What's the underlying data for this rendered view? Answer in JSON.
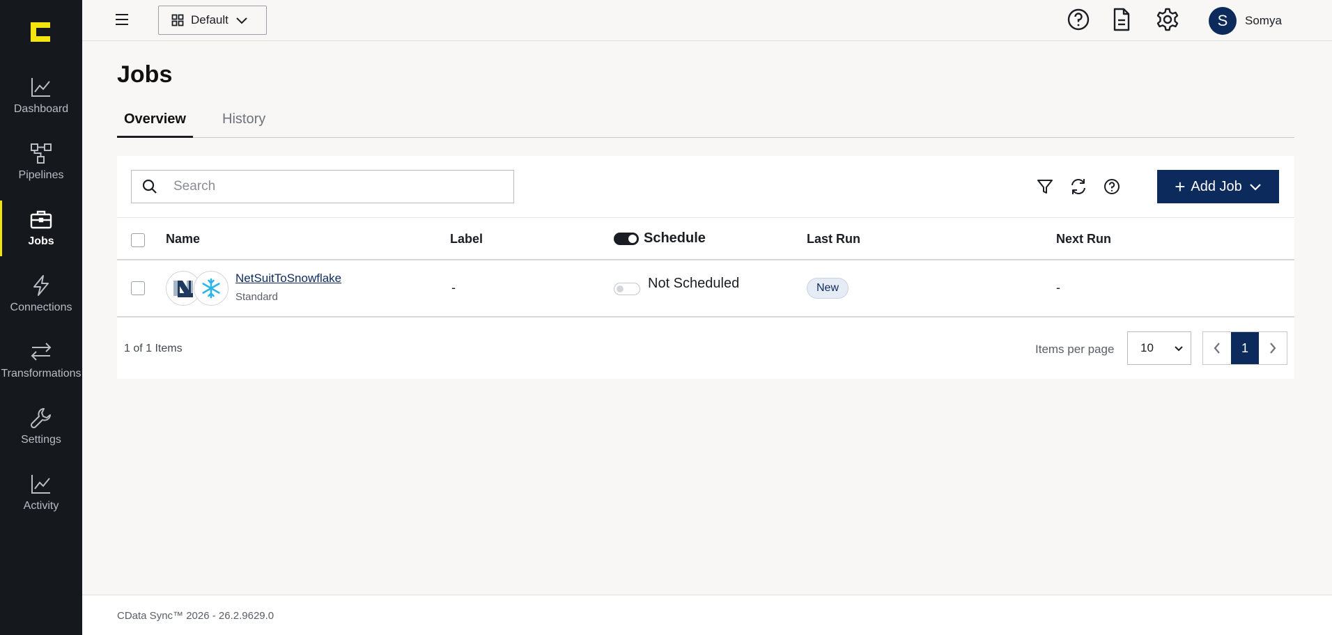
{
  "colors": {
    "sidebar_bg": "#15181d",
    "accent_yellow": "#f2e40e",
    "primary_navy": "#0c2a5c"
  },
  "sidebar": {
    "items": [
      {
        "label": "Dashboard",
        "icon": "chart-line-icon"
      },
      {
        "label": "Pipelines",
        "icon": "pipeline-icon"
      },
      {
        "label": "Jobs",
        "icon": "briefcase-icon",
        "active": true
      },
      {
        "label": "Connections",
        "icon": "lightning-icon"
      },
      {
        "label": "Transformations",
        "icon": "arrows-exchange-icon"
      },
      {
        "label": "Settings",
        "icon": "wrench-icon"
      },
      {
        "label": "Activity",
        "icon": "activity-chart-icon"
      }
    ]
  },
  "header": {
    "workspace": "Default",
    "icons": [
      "help-icon",
      "document-icon",
      "gear-icon"
    ],
    "user": {
      "initial": "S",
      "name": "Somya"
    }
  },
  "page": {
    "title": "Jobs",
    "tabs": [
      {
        "label": "Overview",
        "active": true
      },
      {
        "label": "History",
        "active": false
      }
    ]
  },
  "toolbar": {
    "search_placeholder": "Search",
    "add_job_label": "Add Job"
  },
  "table": {
    "columns": {
      "name": "Name",
      "label": "Label",
      "schedule": "Schedule",
      "last_run": "Last Run",
      "next_run": "Next Run"
    },
    "rows": [
      {
        "name": "NetSuitToSnowflake",
        "type": "Standard",
        "label": "-",
        "schedule": "Not Scheduled",
        "last_run": "New",
        "next_run": "-"
      }
    ]
  },
  "pagination": {
    "count_text": "1 of 1 Items",
    "items_per_page_label": "Items per page",
    "items_per_page": "10",
    "current_page": "1"
  },
  "footer": {
    "version": "CData Sync™ 2026 - 26.2.9629.0"
  }
}
